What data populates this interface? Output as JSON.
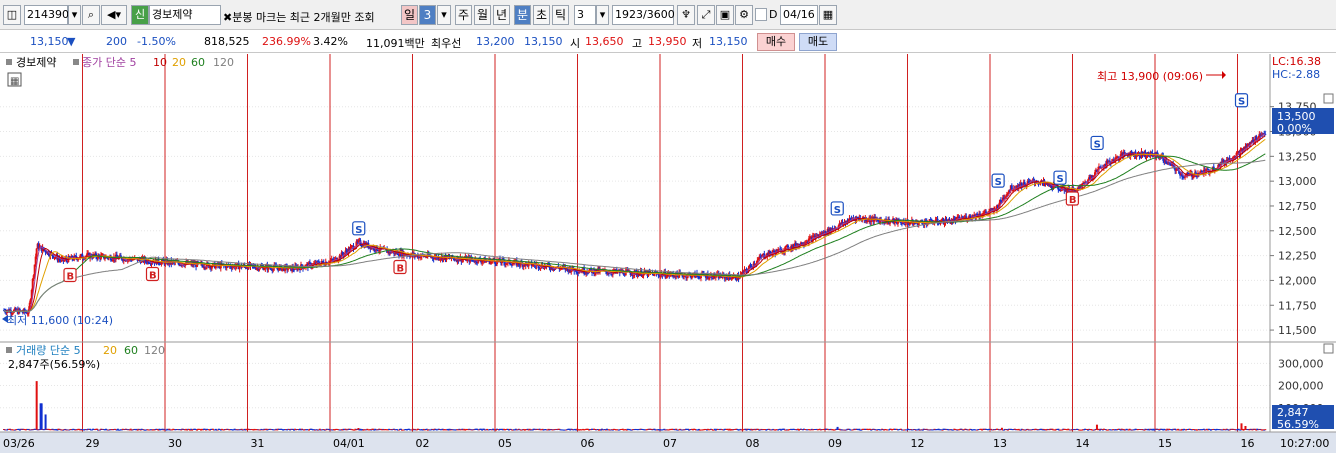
{
  "toolbar": {
    "code": "214390",
    "name_badge": "신",
    "stock_name": "경보제약",
    "notice": "분봉 마크는 최근 2개월만 조회",
    "periods": [
      "일",
      "3",
      "주",
      "월",
      "년",
      "분",
      "초",
      "틱"
    ],
    "interval": "3",
    "count": "1923",
    "count_total": "/3600",
    "date_checkbox_label": "D",
    "date": "04/16"
  },
  "quote": {
    "price": "13,150",
    "change_arrow": "▼",
    "change": "200",
    "change_pct": "-1.50%",
    "volume": "818,525",
    "volume_ratio": "236.99%",
    "turnover": "3.42%",
    "amount": "11,091백만",
    "best_ask_label": "최우선",
    "best_ask": "13,200",
    "best_bid": "13,150",
    "open_label": "시",
    "open": "13,650",
    "high_label": "고",
    "high": "13,950",
    "low_label": "저",
    "low": "13,150",
    "buy_label": "매수",
    "sell_label": "매도"
  },
  "chart_data": {
    "type": "candlestick",
    "price_panel": {
      "legend_name": "경보제약",
      "legend_ma": "종가 단순 5",
      "ma_periods": [
        {
          "p": "10",
          "color": "#c00000"
        },
        {
          "p": "20",
          "color": "#e0a000"
        },
        {
          "p": "60",
          "color": "#208020"
        },
        {
          "p": "120",
          "color": "#808080"
        }
      ],
      "y_ticks": [
        "13,750",
        "13,500",
        "13,250",
        "13,000",
        "12,750",
        "12,500",
        "12,250",
        "12,000",
        "11,750",
        "11,500"
      ],
      "ylim": [
        11400,
        14180
      ],
      "lc_label": "LC:16.38",
      "hc_label": "HC:-2.88",
      "current_price_tag": "13,500",
      "current_pct_tag": "0.00%",
      "high_annotation": "최고 13,900 (09:06)",
      "low_annotation": "최저 11,600 (10:24)",
      "marks": [
        {
          "type": "B",
          "day": 0.8,
          "price": 12050
        },
        {
          "type": "B",
          "day": 1.8,
          "price": 12060
        },
        {
          "type": "S",
          "day": 4.3,
          "price": 12520
        },
        {
          "type": "B",
          "day": 4.8,
          "price": 12130
        },
        {
          "type": "S",
          "day": 10.1,
          "price": 12720
        },
        {
          "type": "S",
          "day": 12.05,
          "price": 13000
        },
        {
          "type": "S",
          "day": 12.8,
          "price": 13030
        },
        {
          "type": "B",
          "day": 12.95,
          "price": 12820
        },
        {
          "type": "S",
          "day": 13.25,
          "price": 13380
        },
        {
          "type": "S",
          "day": 15.0,
          "price": 13810
        }
      ],
      "path": [
        [
          0,
          11700
        ],
        [
          0.3,
          11680
        ],
        [
          0.4,
          12350
        ],
        [
          0.7,
          12200
        ],
        [
          1.0,
          12250
        ],
        [
          1.5,
          12220
        ],
        [
          2.0,
          12180
        ],
        [
          2.5,
          12150
        ],
        [
          3.0,
          12140
        ],
        [
          3.5,
          12120
        ],
        [
          4.0,
          12200
        ],
        [
          4.3,
          12380
        ],
        [
          4.6,
          12300
        ],
        [
          5.0,
          12250
        ],
        [
          5.5,
          12220
        ],
        [
          6.0,
          12190
        ],
        [
          6.5,
          12150
        ],
        [
          7.0,
          12100
        ],
        [
          7.5,
          12080
        ],
        [
          8.0,
          12060
        ],
        [
          8.5,
          12050
        ],
        [
          8.9,
          12030
        ],
        [
          9.2,
          12250
        ],
        [
          9.6,
          12350
        ],
        [
          10.0,
          12500
        ],
        [
          10.3,
          12630
        ],
        [
          10.7,
          12600
        ],
        [
          11.0,
          12580
        ],
        [
          11.5,
          12600
        ],
        [
          12.0,
          12700
        ],
        [
          12.2,
          12930
        ],
        [
          12.5,
          13000
        ],
        [
          12.8,
          12930
        ],
        [
          13.0,
          12900
        ],
        [
          13.3,
          13150
        ],
        [
          13.6,
          13280
        ],
        [
          14.0,
          13260
        ],
        [
          14.3,
          13050
        ],
        [
          14.6,
          13100
        ],
        [
          15.0,
          13300
        ],
        [
          15.2,
          13450
        ],
        [
          15.3,
          13500
        ]
      ]
    },
    "volume_panel": {
      "legend": "거래량 단순 5",
      "ma_periods": [
        {
          "p": "20",
          "color": "#e0a000"
        },
        {
          "p": "60",
          "color": "#208020"
        },
        {
          "p": "120",
          "color": "#808080"
        }
      ],
      "last_value": "2,847주(56.59%)",
      "y_ticks": [
        "300,000",
        "200,000",
        "100,000"
      ],
      "ylim": [
        0,
        360000
      ],
      "current_tag": "2,847",
      "current_pct_tag": "56.59%",
      "spikes": [
        [
          0.4,
          220000
        ],
        [
          0.45,
          120000
        ],
        [
          0.5,
          70000
        ],
        [
          4.3,
          9000
        ],
        [
          10.1,
          14000
        ],
        [
          12.1,
          10000
        ],
        [
          13.25,
          24000
        ],
        [
          15.0,
          30000
        ],
        [
          15.05,
          18000
        ]
      ]
    },
    "x_axis": {
      "labels": [
        "03/26",
        "29",
        "30",
        "31",
        "04/01",
        "02",
        "05",
        "06",
        "07",
        "08",
        "09",
        "12",
        "13",
        "14",
        "15",
        "16"
      ],
      "time_label": "10:27:00"
    }
  }
}
